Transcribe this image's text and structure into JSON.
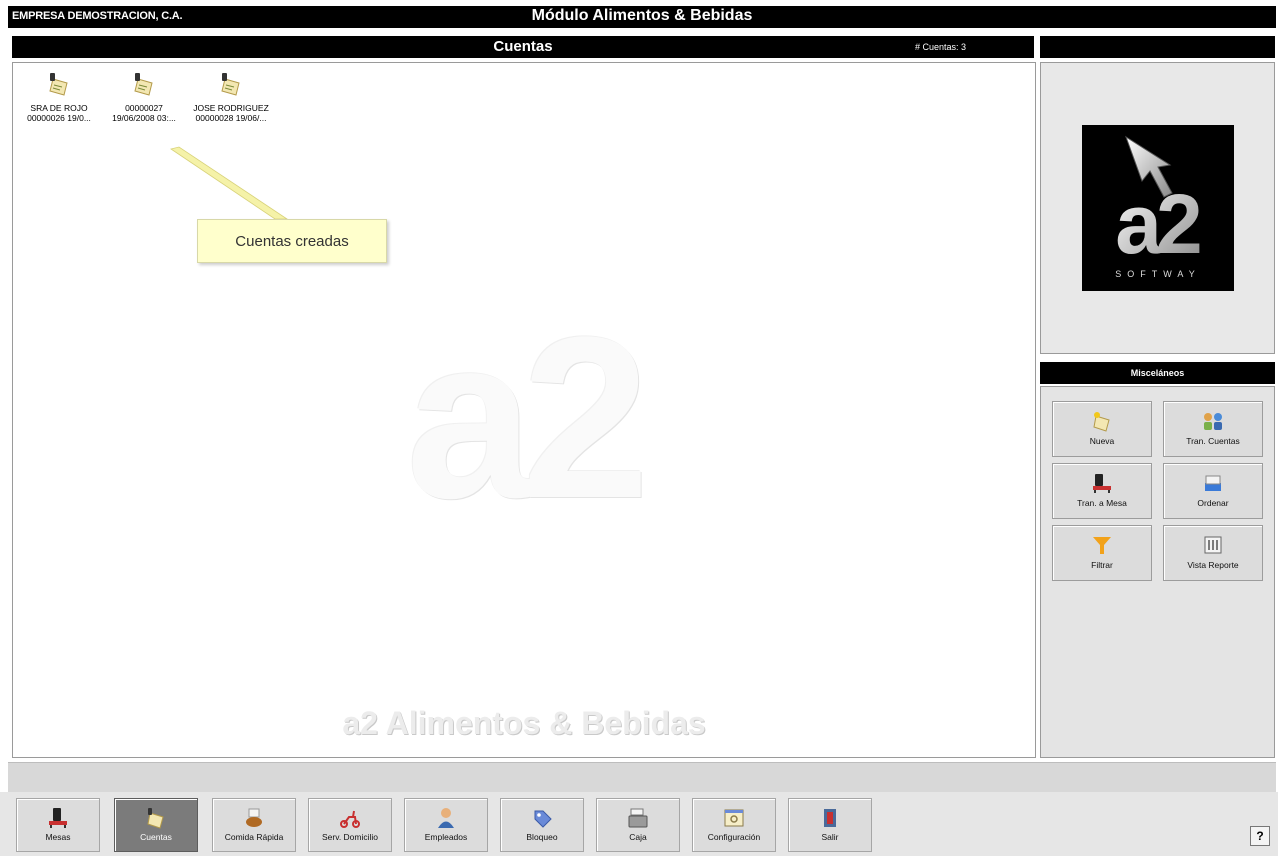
{
  "titlebar": {
    "company": "EMPRESA DEMOSTRACION, C.A.",
    "module": "Módulo Alimentos & Bebidas"
  },
  "section": {
    "title": "Cuentas",
    "count": "# Cuentas: 3"
  },
  "accounts": [
    {
      "line1": "SRA DE ROJO",
      "line2": "00000026 19/0..."
    },
    {
      "line1": "00000027",
      "line2": "19/06/2008 03:..."
    },
    {
      "line1": "JOSE RODRIGUEZ",
      "line2": "00000028 19/06/..."
    }
  ],
  "callout": "Cuentas creadas",
  "watermark": {
    "big": "a2",
    "bottom": "a2 Alimentos & Bebidas"
  },
  "logo": {
    "brand": "a2",
    "tagline": "SOFTWAY"
  },
  "misc": {
    "title": "Misceláneos",
    "buttons": [
      {
        "label": "Nueva",
        "icon": "new-account-icon"
      },
      {
        "label": "Tran. Cuentas",
        "icon": "transfer-accounts-icon"
      },
      {
        "label": "Tran. a Mesa",
        "icon": "transfer-table-icon"
      },
      {
        "label": "Ordenar",
        "icon": "sort-icon"
      },
      {
        "label": "Filtrar",
        "icon": "filter-icon"
      },
      {
        "label": "Vista Reporte",
        "icon": "report-view-icon"
      }
    ]
  },
  "toolbar": {
    "active": "Cuentas",
    "buttons": [
      {
        "label": "Mesas",
        "icon": "tables-icon"
      },
      {
        "label": "Cuentas",
        "icon": "accounts-icon"
      },
      {
        "label": "Comida Rápida",
        "icon": "fast-food-icon"
      },
      {
        "label": "Serv. Domicilio",
        "icon": "delivery-icon"
      },
      {
        "label": "Empleados",
        "icon": "employees-icon"
      },
      {
        "label": "Bloqueo",
        "icon": "lock-tag-icon"
      },
      {
        "label": "Caja",
        "icon": "cash-register-icon"
      },
      {
        "label": "Configuración",
        "icon": "settings-icon"
      },
      {
        "label": "Salir",
        "icon": "exit-door-icon"
      }
    ],
    "help": "?"
  },
  "colors": {
    "bar": "#000000",
    "panel": "#e4e4e4",
    "active": "#7b7b7b",
    "callout": "#ffffcc"
  }
}
